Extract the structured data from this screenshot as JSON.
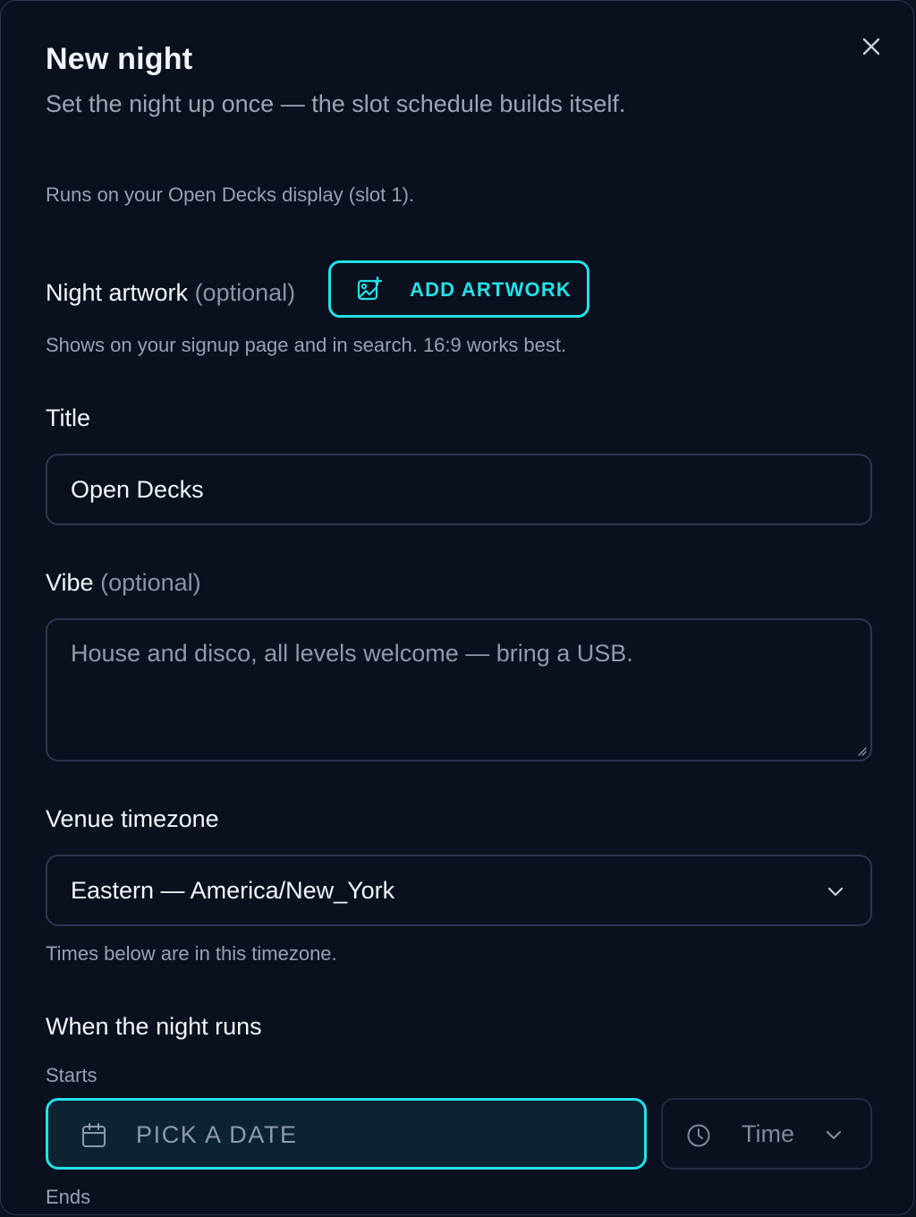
{
  "dialog": {
    "title": "New night",
    "subtitle": "Set the night up once — the slot schedule builds itself.",
    "runs_on": "Runs on your Open Decks display (slot 1).",
    "close_icon": "close-icon"
  },
  "artwork": {
    "label": "Night artwork",
    "optional": "(optional)",
    "button_label": "ADD ARTWORK",
    "button_icon": "image-add-icon",
    "help": "Shows on your signup page and in search. 16:9 works best."
  },
  "title_field": {
    "label": "Title",
    "value": "Open Decks"
  },
  "vibe_field": {
    "label": "Vibe",
    "optional": "(optional)",
    "placeholder": "House and disco, all levels welcome — bring a USB."
  },
  "timezone": {
    "label": "Venue timezone",
    "selected": "Eastern — America/New_York",
    "help": "Times below are in this timezone."
  },
  "schedule": {
    "section_label": "When the night runs",
    "starts_label": "Starts",
    "date_placeholder": "PICK A DATE",
    "time_placeholder": "Time",
    "ends_label": "Ends"
  },
  "colors": {
    "accent": "#22e1e8",
    "background": "#0a101e",
    "border": "#2b3650",
    "text": "#f2f5fa",
    "muted": "#97a1b3"
  }
}
